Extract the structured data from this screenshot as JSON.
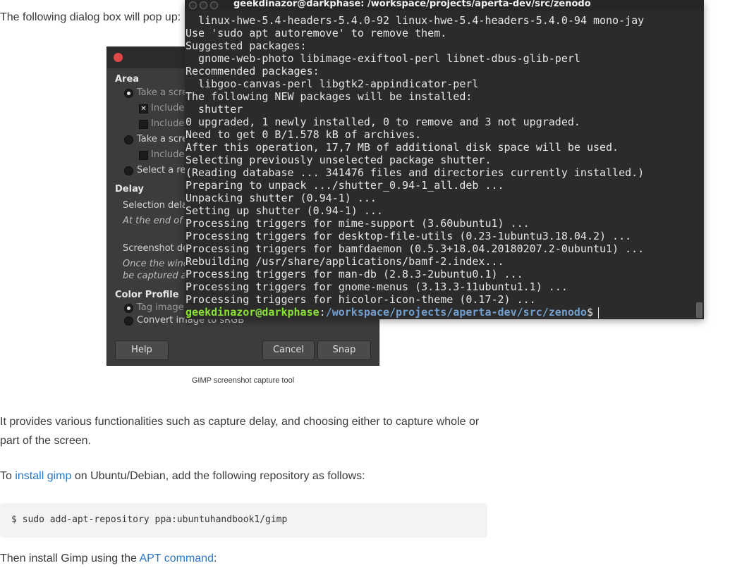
{
  "article": {
    "intro": "The following dialog box will pop up:",
    "caption": "GIMP screenshot capture tool",
    "para1": "It provides various functionalities such as capture delay, and choosing either to capture whole or part of the screen.",
    "para2_pre": "To ",
    "para2_link": "install gimp",
    "para2_post": " on Ubuntu/Debian, add the following repository as follows:",
    "code": "$ sudo add-apt-repository ppa:ubuntuhandbook1/gimp",
    "para3_pre": "Then install Gimp using the ",
    "para3_link": "APT command",
    "para3_post": ":"
  },
  "gimp_dialog": {
    "area_label": "Area",
    "opt_take_screenshot": "Take a scree",
    "opt_include_1": "Include v",
    "opt_include_2": "Include r",
    "opt_take_screenshot_2": "Take a scree",
    "opt_include_3": "Include r",
    "opt_select_region": "Select a regi",
    "delay_label": "Delay",
    "selection_delay": "Selection delay",
    "at_the_end": "At the end of th",
    "screenshot_delay": "Screenshot dela",
    "once_the_window": "Once the windo",
    "be_captured": "be captured afte",
    "color_profile_label": "Color Profile",
    "tag_image": "Tag image w",
    "convert_image": "Convert image to sRGB",
    "help_button": "Help",
    "cancel_button": "Cancel",
    "snap_button": "Snap"
  },
  "terminal": {
    "title": "geekdinazor@darkphase: /workspace/projects/aperta-dev/src/zenodo",
    "lines": [
      "  linux-hwe-5.4-headers-5.4.0-92 linux-hwe-5.4-headers-5.4.0-94 mono-jay",
      "Use 'sudo apt autoremove' to remove them.",
      "Suggested packages:",
      "  gnome-web-photo libimage-exiftool-perl libnet-dbus-glib-perl",
      "Recommended packages:",
      "  libgoo-canvas-perl libgtk2-appindicator-perl",
      "The following NEW packages will be installed:",
      "  shutter",
      "0 upgraded, 1 newly installed, 0 to remove and 3 not upgraded.",
      "Need to get 0 B/1.578 kB of archives.",
      "After this operation, 17,7 MB of additional disk space will be used.",
      "Selecting previously unselected package shutter.",
      "(Reading database ... 341476 files and directories currently installed.)",
      "Preparing to unpack .../shutter_0.94-1_all.deb ...",
      "Unpacking shutter (0.94-1) ...",
      "Setting up shutter (0.94-1) ...",
      "Processing triggers for mime-support (3.60ubuntu1) ...",
      "Processing triggers for desktop-file-utils (0.23-1ubuntu3.18.04.2) ...",
      "Processing triggers for bamfdaemon (0.5.3+18.04.20180207.2-0ubuntu1) ...",
      "Rebuilding /usr/share/applications/bamf-2.index...",
      "Processing triggers for man-db (2.8.3-2ubuntu0.1) ...",
      "Processing triggers for gnome-menus (3.13.3-11ubuntu1.1) ...",
      "Processing triggers for hicolor-icon-theme (0.17-2) ..."
    ],
    "prompt_user": "geekdinazor@darkphase",
    "prompt_sep": ":",
    "prompt_path": "/workspace/projects/aperta-dev/src/zenodo",
    "prompt_symbol": "$"
  }
}
